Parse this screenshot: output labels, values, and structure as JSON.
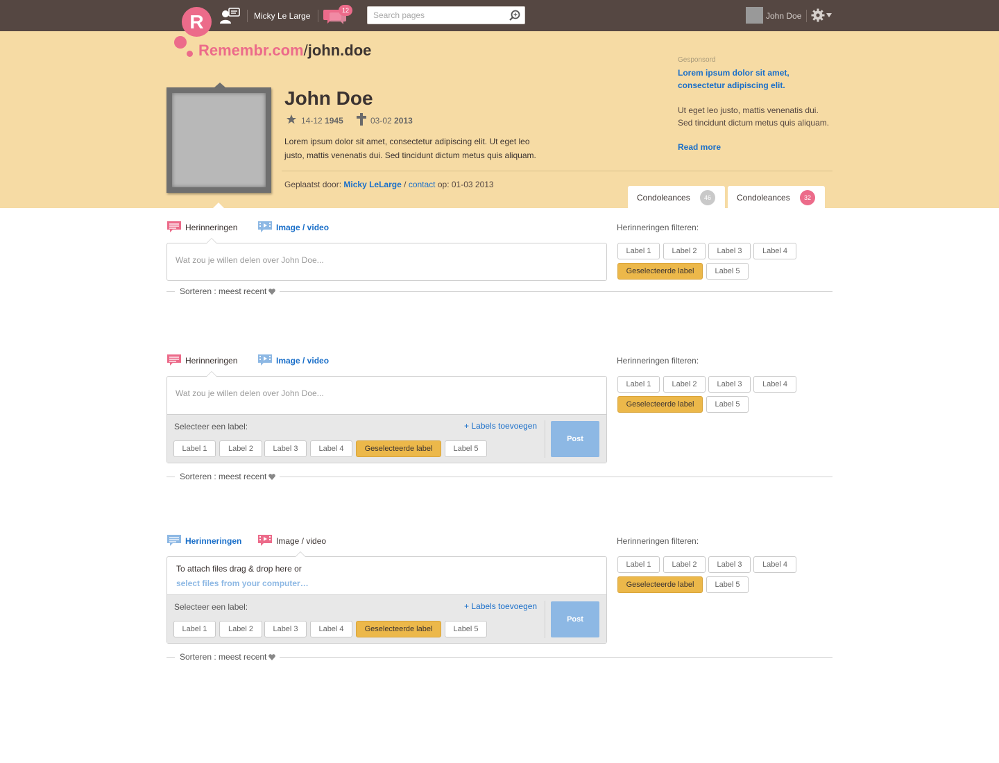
{
  "topbar": {
    "logo_letter": "R",
    "username": "Micky Le Large",
    "message_count": "12",
    "search_placeholder": "Search pages",
    "account_name": "John Doe"
  },
  "site": {
    "brand": "Remembr.com",
    "slash": "/",
    "handle": "john.doe"
  },
  "profile": {
    "name": "John Doe",
    "birth_day": "14-12",
    "birth_year": "1945",
    "death_day": "03-02",
    "death_year": "2013",
    "bio": "Lorem ipsum dolor sit amet, consectetur adipiscing elit. Ut eget leo justo, mattis venenatis dui. Sed tincidunt dictum metus quis aliquam.",
    "posted_prefix": "Geplaatst door:",
    "posted_by": "Micky LeLarge",
    "posted_sep": "/",
    "contact": "contact",
    "posted_date": "op: 01-03 2013"
  },
  "sponsor": {
    "label": "Gesponsord",
    "title": "Lorem ipsum dolor sit amet, consectetur adipiscing elit.",
    "body": "Ut eget leo justo, mattis venenatis dui. Sed tincidunt dictum metus quis aliquam.",
    "read_more": "Read more"
  },
  "tabs": [
    {
      "label": "Condoleances",
      "count": "46",
      "badge_color": "#c9c9c9"
    },
    {
      "label": "Condoleances",
      "count": "32",
      "badge_color": "#ec6b8a"
    }
  ],
  "composer_tabs": {
    "memories": "Herinneringen",
    "media": "Image / video"
  },
  "composer": {
    "placeholder": "Wat zou je willen delen over John Doe...",
    "drop_text": "To attach files drag & drop here or",
    "drop_link": "select files from your computer…",
    "select_label": "Selecteer een label:",
    "add_labels": "+ Labels toevoegen",
    "post": "Post",
    "labels": [
      "Label 1",
      "Label 2",
      "Label 3",
      "Label 4",
      "Geselecteerde label",
      "Label 5"
    ]
  },
  "filter": {
    "title": "Herinneringen filteren:",
    "labels": [
      "Label 1",
      "Label 2",
      "Label 3",
      "Label 4",
      "Geselecteerde label",
      "Label 5"
    ]
  },
  "sort": {
    "label": "Sorteren : meest recent"
  },
  "colors": {
    "topbar": "#554742",
    "header": "#f6dba4",
    "accent_pink": "#ec6b8a",
    "link_blue": "#1a6fc9",
    "selected_label": "#ecb84a",
    "post_button": "#8db8e4"
  }
}
